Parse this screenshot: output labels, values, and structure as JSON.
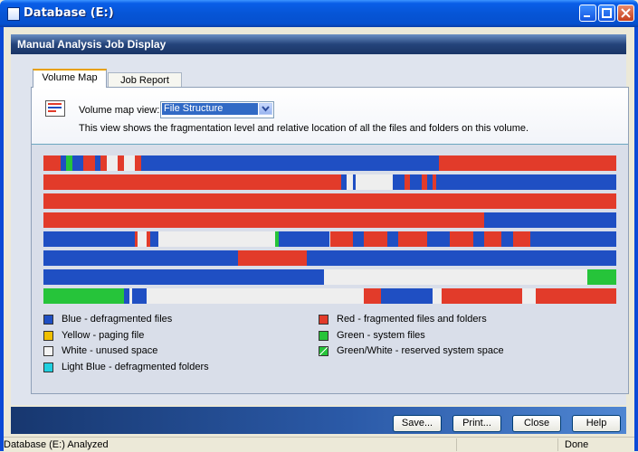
{
  "window": {
    "title": "Database (E:)"
  },
  "header": {
    "title": "Manual Analysis Job Display"
  },
  "tabs": [
    {
      "label": "Volume Map"
    },
    {
      "label": "Job Report"
    }
  ],
  "view": {
    "label": "Volume map view:",
    "selected": "File Structure",
    "description": "This view shows the fragmentation level and relative location of all the files and folders on this volume."
  },
  "colors": {
    "blue": "#1f4fc3",
    "red": "#e23b2a",
    "white": "#eeeeee",
    "green": "#26c43a",
    "yellow": "#f0c000",
    "lightblue": "#20d0e0"
  },
  "map_rows": [
    [
      [
        "red",
        0,
        3
      ],
      [
        "blue",
        3,
        4
      ],
      [
        "green",
        4,
        5
      ],
      [
        "blue",
        5,
        7
      ],
      [
        "red",
        7,
        9
      ],
      [
        "blue",
        9,
        10
      ],
      [
        "red",
        10,
        11
      ],
      [
        "white",
        11,
        13
      ],
      [
        "red",
        13,
        14
      ],
      [
        "white",
        14,
        16
      ],
      [
        "red",
        16,
        17
      ],
      [
        "blue",
        17,
        69
      ],
      [
        "red",
        69,
        100
      ]
    ],
    [
      [
        "red",
        0,
        52
      ],
      [
        "blue",
        52,
        53
      ],
      [
        "white",
        53,
        54
      ],
      [
        "blue",
        54,
        54.5
      ],
      [
        "white",
        54.5,
        61
      ],
      [
        "blue",
        61,
        63
      ],
      [
        "red",
        63,
        64
      ],
      [
        "blue",
        64,
        66
      ],
      [
        "red",
        66,
        67
      ],
      [
        "blue",
        67,
        68
      ],
      [
        "red",
        68,
        68.6
      ],
      [
        "blue",
        68.6,
        100
      ]
    ],
    [
      [
        "red",
        0,
        100
      ]
    ],
    [
      [
        "red",
        0,
        77
      ],
      [
        "blue",
        77,
        100
      ]
    ],
    [
      [
        "blue",
        0,
        16
      ],
      [
        "red",
        16,
        16.5
      ],
      [
        "white",
        16.5,
        18
      ],
      [
        "red",
        18,
        18.6
      ],
      [
        "blue",
        18.6,
        20
      ],
      [
        "white",
        20,
        40.5
      ],
      [
        "green",
        40.5,
        41
      ],
      [
        "blue",
        41,
        50
      ],
      [
        "red",
        50,
        54
      ],
      [
        "blue",
        54,
        56
      ],
      [
        "red",
        56,
        60
      ],
      [
        "blue",
        60,
        62
      ],
      [
        "red",
        62,
        67
      ],
      [
        "blue",
        67,
        71
      ],
      [
        "red",
        71,
        75
      ],
      [
        "blue",
        75,
        77
      ],
      [
        "red",
        77,
        80
      ],
      [
        "blue",
        80,
        82
      ],
      [
        "red",
        82,
        85
      ],
      [
        "blue",
        85,
        100
      ]
    ],
    [
      [
        "blue",
        0,
        34
      ],
      [
        "red",
        34,
        46
      ],
      [
        "blue",
        46,
        100
      ]
    ],
    [
      [
        "blue",
        0,
        49
      ],
      [
        "white",
        49,
        95
      ],
      [
        "green",
        95,
        100
      ]
    ],
    [
      [
        "green",
        0,
        14
      ],
      [
        "blue",
        14,
        15
      ],
      [
        "white",
        15,
        15.5
      ],
      [
        "blue",
        15.5,
        18
      ],
      [
        "white",
        18,
        56
      ],
      [
        "red",
        56,
        59
      ],
      [
        "blue",
        59,
        68
      ],
      [
        "white",
        68,
        69.5
      ],
      [
        "red",
        69.5,
        83.5
      ],
      [
        "white",
        83.5,
        86
      ],
      [
        "red",
        86,
        100
      ]
    ]
  ],
  "legend": [
    {
      "color": "#1f4fc3",
      "label": "Blue - defragmented files"
    },
    {
      "color": "#f0c000",
      "label": "Yellow - paging file"
    },
    {
      "color": "#f4f4f4",
      "label": "White - unused space"
    },
    {
      "color": "#20d0e0",
      "label": "Light Blue - defragmented folders"
    },
    {
      "color": "#e23b2a",
      "label": "Red - fragmented files and folders"
    },
    {
      "color": "#26c43a",
      "label": "Green - system files"
    },
    {
      "color": "striped",
      "label": "Green/White - reserved system space"
    }
  ],
  "buttons": {
    "save": "Save...",
    "print": "Print...",
    "close": "Close",
    "help": "Help"
  },
  "status": {
    "left": "Database (E:) Analyzed",
    "right": "Done"
  }
}
